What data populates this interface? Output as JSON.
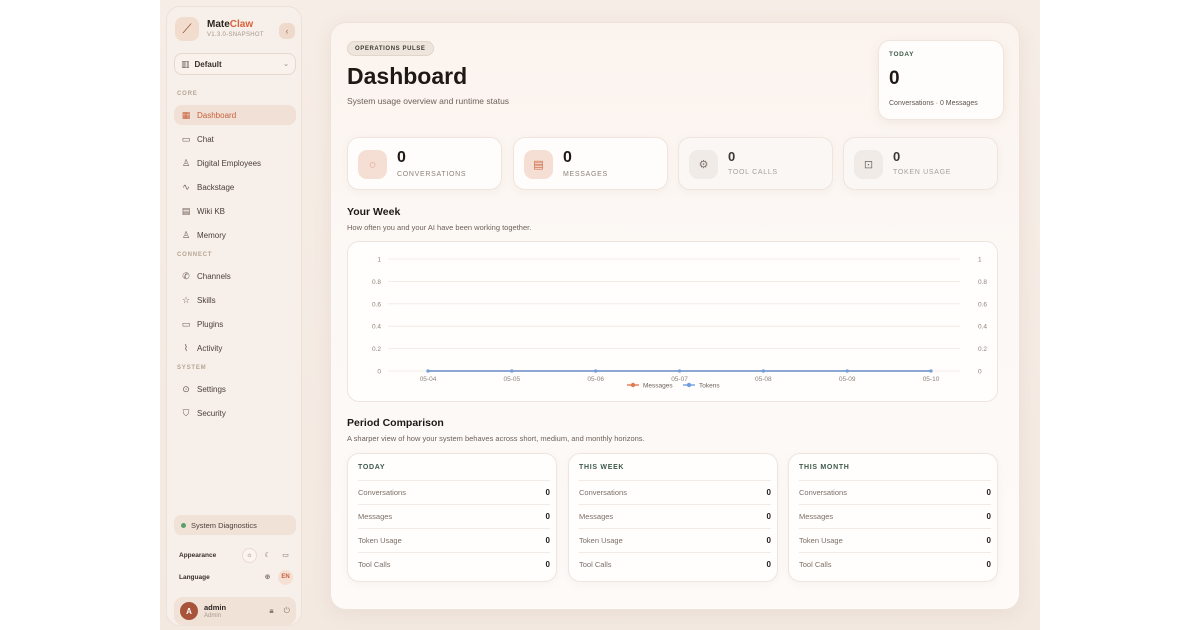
{
  "brand": {
    "name_prefix": "Mate",
    "name_accent": "Claw",
    "version": "V1.3.0-SNAPSHOT",
    "logo_icon": "claw-logo-icon"
  },
  "sidebar": {
    "workspace": "Default",
    "sections": {
      "core": "CORE",
      "connect": "CONNECT",
      "system": "SYSTEM"
    },
    "items": [
      {
        "label": "Dashboard",
        "icon": "grid-icon",
        "active": true
      },
      {
        "label": "Chat",
        "icon": "chat-icon"
      },
      {
        "label": "Digital Employees",
        "icon": "user-icon"
      },
      {
        "label": "Backstage",
        "icon": "pulse-icon"
      },
      {
        "label": "Wiki KB",
        "icon": "book-icon"
      },
      {
        "label": "Memory",
        "icon": "person-icon"
      },
      {
        "label": "Channels",
        "icon": "phone-icon"
      },
      {
        "label": "Skills",
        "icon": "star-icon"
      },
      {
        "label": "Plugins",
        "icon": "briefcase-icon"
      },
      {
        "label": "Activity",
        "icon": "activity-icon"
      },
      {
        "label": "Settings",
        "icon": "settings-icon"
      },
      {
        "label": "Security",
        "icon": "shield-icon"
      }
    ],
    "diagnostics": "System Diagnostics",
    "appearance_label": "Appearance",
    "language_label": "Language",
    "language_value": "EN",
    "user": {
      "name": "admin",
      "role": "Admin",
      "initial": "A"
    }
  },
  "header": {
    "badge": "OPERATIONS PULSE",
    "title": "Dashboard",
    "subtitle": "System usage overview and runtime status",
    "today": {
      "label": "TODAY",
      "value": "0",
      "sub": "Conversations · 0 Messages"
    }
  },
  "stats": [
    {
      "value": "0",
      "label": "CONVERSATIONS",
      "icon": "chat-bubble-icon"
    },
    {
      "value": "0",
      "label": "MESSAGES",
      "icon": "document-icon"
    },
    {
      "value": "0",
      "label": "TOOL CALLS",
      "icon": "gear-icon"
    },
    {
      "value": "0",
      "label": "TOKEN USAGE",
      "icon": "presentation-icon"
    }
  ],
  "week": {
    "title": "Your Week",
    "subtitle": "How often you and your AI have been working together."
  },
  "chart_data": {
    "type": "line",
    "x": [
      "05-04",
      "05-05",
      "05-06",
      "05-07",
      "05-08",
      "05-09",
      "05-10"
    ],
    "series": [
      {
        "name": "Messages",
        "values": [
          0,
          0,
          0,
          0,
          0,
          0,
          0
        ],
        "color": "#e07a52"
      },
      {
        "name": "Tokens",
        "values": [
          0,
          0,
          0,
          0,
          0,
          0,
          0
        ],
        "color": "#6e9fe0"
      }
    ],
    "yticks": [
      "0",
      "0.2",
      "0.4",
      "0.6",
      "0.8",
      "1"
    ],
    "ylim": [
      0,
      1
    ],
    "grid": true,
    "legend": "bottom-center"
  },
  "period": {
    "title": "Period Comparison",
    "subtitle": "A sharper view of how your system behaves across short, medium, and monthly horizons.",
    "cards": [
      {
        "title": "TODAY",
        "rows": [
          {
            "label": "Conversations",
            "value": "0"
          },
          {
            "label": "Messages",
            "value": "0"
          },
          {
            "label": "Token Usage",
            "value": "0"
          },
          {
            "label": "Tool Calls",
            "value": "0"
          }
        ]
      },
      {
        "title": "THIS WEEK",
        "rows": [
          {
            "label": "Conversations",
            "value": "0"
          },
          {
            "label": "Messages",
            "value": "0"
          },
          {
            "label": "Token Usage",
            "value": "0"
          },
          {
            "label": "Tool Calls",
            "value": "0"
          }
        ]
      },
      {
        "title": "THIS MONTH",
        "rows": [
          {
            "label": "Conversations",
            "value": "0"
          },
          {
            "label": "Messages",
            "value": "0"
          },
          {
            "label": "Token Usage",
            "value": "0"
          },
          {
            "label": "Tool Calls",
            "value": "0"
          }
        ]
      }
    ]
  }
}
